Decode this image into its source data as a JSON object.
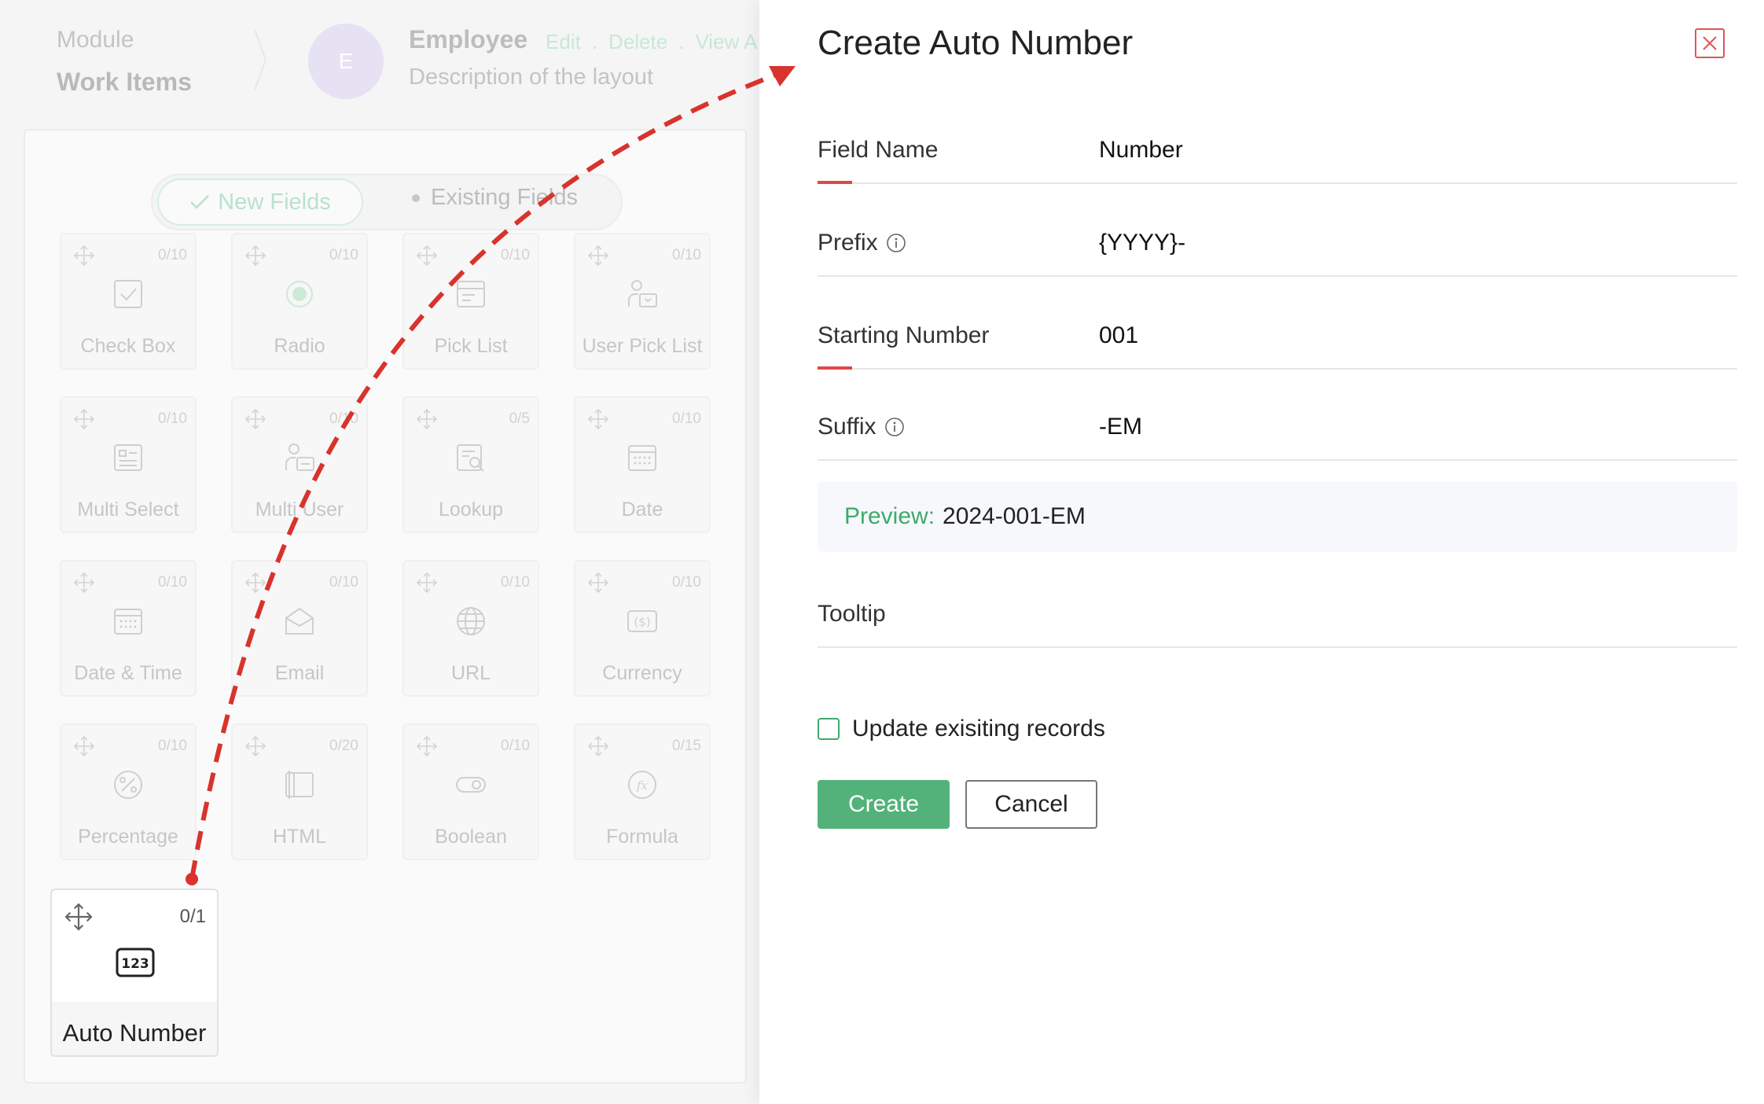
{
  "background": {
    "module_label": "Module",
    "module_value": "Work Items",
    "avatar_letter": "E",
    "layout_title": "Employee",
    "layout_links": [
      "Edit",
      ".",
      "Delete",
      ".",
      "View A"
    ],
    "layout_description": "Description of the layout",
    "tabs": {
      "new_fields": "New Fields",
      "existing_fields": "Existing Fields"
    },
    "fields": [
      {
        "label": "Check Box",
        "count": "0/10",
        "icon": "checkbox-icon"
      },
      {
        "label": "Radio",
        "count": "0/10",
        "icon": "radio-icon"
      },
      {
        "label": "Pick List",
        "count": "0/10",
        "icon": "picklist-icon"
      },
      {
        "label": "User Pick List",
        "count": "0/10",
        "icon": "user-picklist-icon"
      },
      {
        "label": "Multi Select",
        "count": "0/10",
        "icon": "multi-select-icon"
      },
      {
        "label": "Multi User",
        "count": "0/10",
        "icon": "multi-user-icon"
      },
      {
        "label": "Lookup",
        "count": "0/5",
        "icon": "lookup-icon"
      },
      {
        "label": "Date",
        "count": "0/10",
        "icon": "calendar-icon"
      },
      {
        "label": "Date & Time",
        "count": "0/10",
        "icon": "datetime-icon"
      },
      {
        "label": "Email",
        "count": "0/10",
        "icon": "email-icon"
      },
      {
        "label": "URL",
        "count": "0/10",
        "icon": "globe-icon"
      },
      {
        "label": "Currency",
        "count": "0/10",
        "icon": "currency-icon"
      },
      {
        "label": "Percentage",
        "count": "0/10",
        "icon": "percentage-icon"
      },
      {
        "label": "HTML",
        "count": "0/20",
        "icon": "html-icon"
      },
      {
        "label": "Boolean",
        "count": "0/10",
        "icon": "toggle-icon"
      },
      {
        "label": "Formula",
        "count": "0/15",
        "icon": "formula-icon"
      }
    ],
    "active_field": {
      "label": "Auto Number",
      "count": "0/1",
      "icon": "auto-number-icon",
      "icon_text": "123"
    }
  },
  "panel": {
    "title": "Create Auto Number",
    "fields": {
      "field_name": {
        "label": "Field Name",
        "value": "Number"
      },
      "prefix": {
        "label": "Prefix",
        "value": "{YYYY}-"
      },
      "starting_number": {
        "label": "Starting Number",
        "value": "001"
      },
      "suffix": {
        "label": "Suffix",
        "value": "-EM"
      },
      "tooltip": {
        "label": "Tooltip",
        "value": ""
      }
    },
    "preview": {
      "label": "Preview:",
      "value": "2024-001-EM"
    },
    "update_checkbox_label": "Update exisiting records",
    "update_checked": false,
    "create_label": "Create",
    "cancel_label": "Cancel"
  },
  "colors": {
    "accent_green": "#52b27a",
    "accent_red": "#e04848",
    "arrow_red": "#d8332c"
  }
}
